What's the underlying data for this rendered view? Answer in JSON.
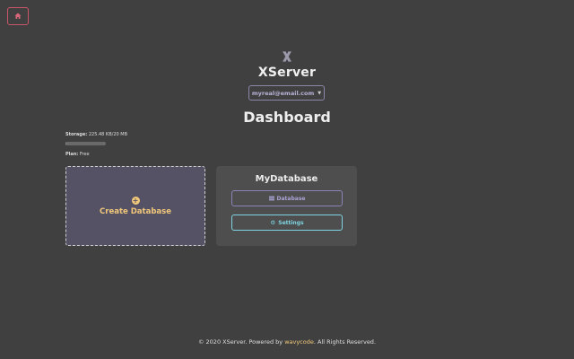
{
  "nav": {
    "home_icon": "home-icon"
  },
  "brand": {
    "logo_icon": "x-logo-icon",
    "title": "XServer"
  },
  "account": {
    "email": "myreal@email.com",
    "caret_icon": "caret-down-icon"
  },
  "page": {
    "title": "Dashboard"
  },
  "storage": {
    "label": "Storage:",
    "value": "225.48 KB/20 MB",
    "used_fraction": 0.011
  },
  "plan": {
    "label": "Plan:",
    "value": "Free"
  },
  "create_card": {
    "icon": "plus-circle-icon",
    "label": "Create Database"
  },
  "database_card": {
    "name": "MyDatabase",
    "database_button": {
      "icon": "list-icon",
      "label": "Database"
    },
    "settings_button": {
      "icon": "gear-icon",
      "label": "Settings"
    }
  },
  "footer": {
    "prefix": "© 2020 XServer. Powered by",
    "link": "wavycode",
    "suffix": ". All Rights Reserved."
  },
  "colors": {
    "background": "#404040",
    "accent_yellow": "#f1c87a",
    "accent_purple": "#aaa4d6",
    "accent_cyan": "#7ed4e2",
    "home_red": "#c9556a"
  }
}
